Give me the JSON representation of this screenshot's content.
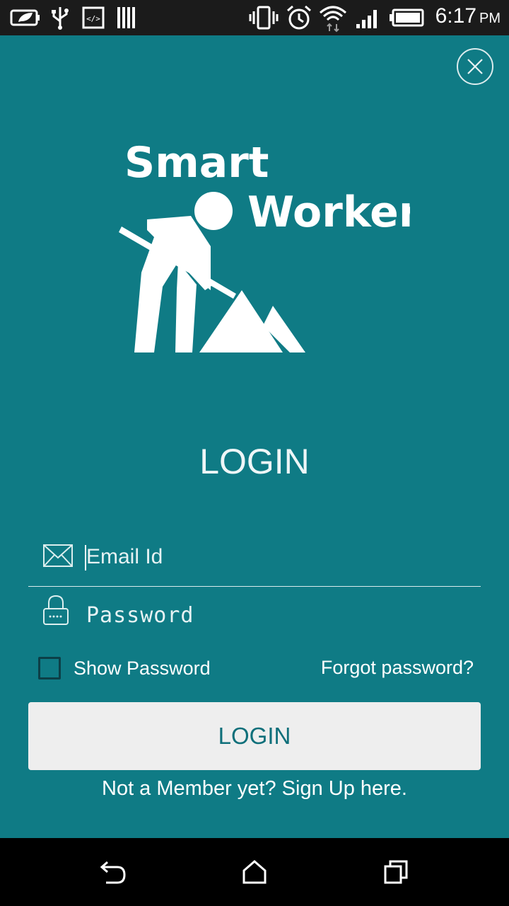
{
  "status_bar": {
    "time": "6:17",
    "ampm": "PM",
    "icons": [
      "battery-saver-icon",
      "usb-icon",
      "developer-icon",
      "barcode-icon",
      "vibrate-icon",
      "alarm-icon",
      "wifi-icon",
      "signal-icon",
      "battery-icon"
    ]
  },
  "logo": {
    "line1": "Smart",
    "line2": "Worker"
  },
  "login": {
    "title": "LOGIN",
    "email_placeholder": "Email Id",
    "password_placeholder": "Password",
    "show_password_label": "Show Password",
    "forgot_password": "Forgot password?",
    "login_button": "LOGIN",
    "signup_text": "Not a Member yet? Sign Up here."
  },
  "colors": {
    "background": "#0f7b85",
    "button_bg": "#eeeeee",
    "button_text": "#0f6f7a"
  },
  "nav": [
    "back-icon",
    "home-icon",
    "recents-icon"
  ]
}
